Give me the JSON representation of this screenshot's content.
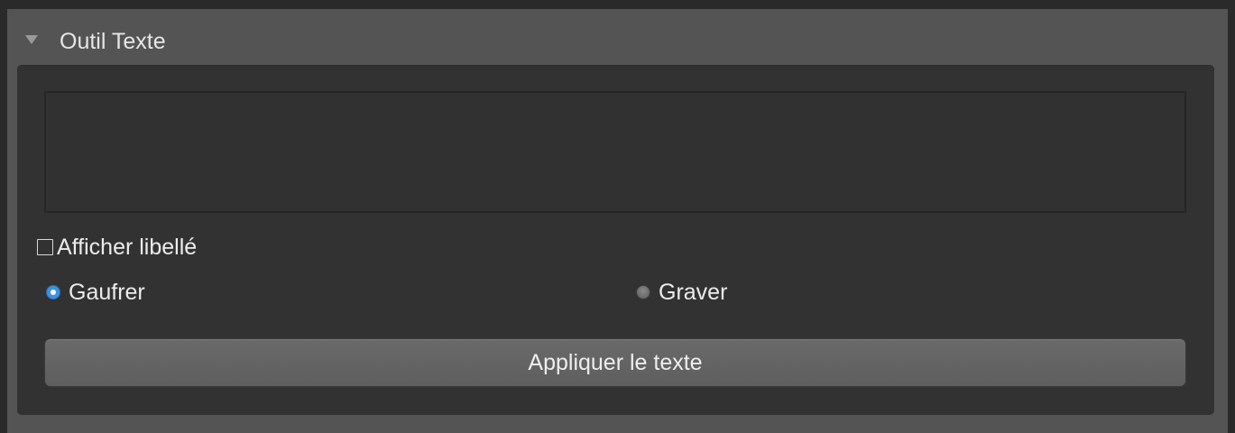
{
  "panel": {
    "title": "Outil Texte",
    "disclosure_icon": "disclosure-triangle-down"
  },
  "text_input": {
    "value": ""
  },
  "show_label": {
    "label": "Afficher libellé",
    "checked": false
  },
  "mode": {
    "options": [
      {
        "label": "Gaufrer",
        "selected": true
      },
      {
        "label": "Graver",
        "selected": false
      }
    ]
  },
  "apply_button": {
    "label": "Appliquer le texte"
  },
  "colors": {
    "panel_bg": "#545454",
    "content_bg": "#323232",
    "accent": "#3b92e0"
  }
}
